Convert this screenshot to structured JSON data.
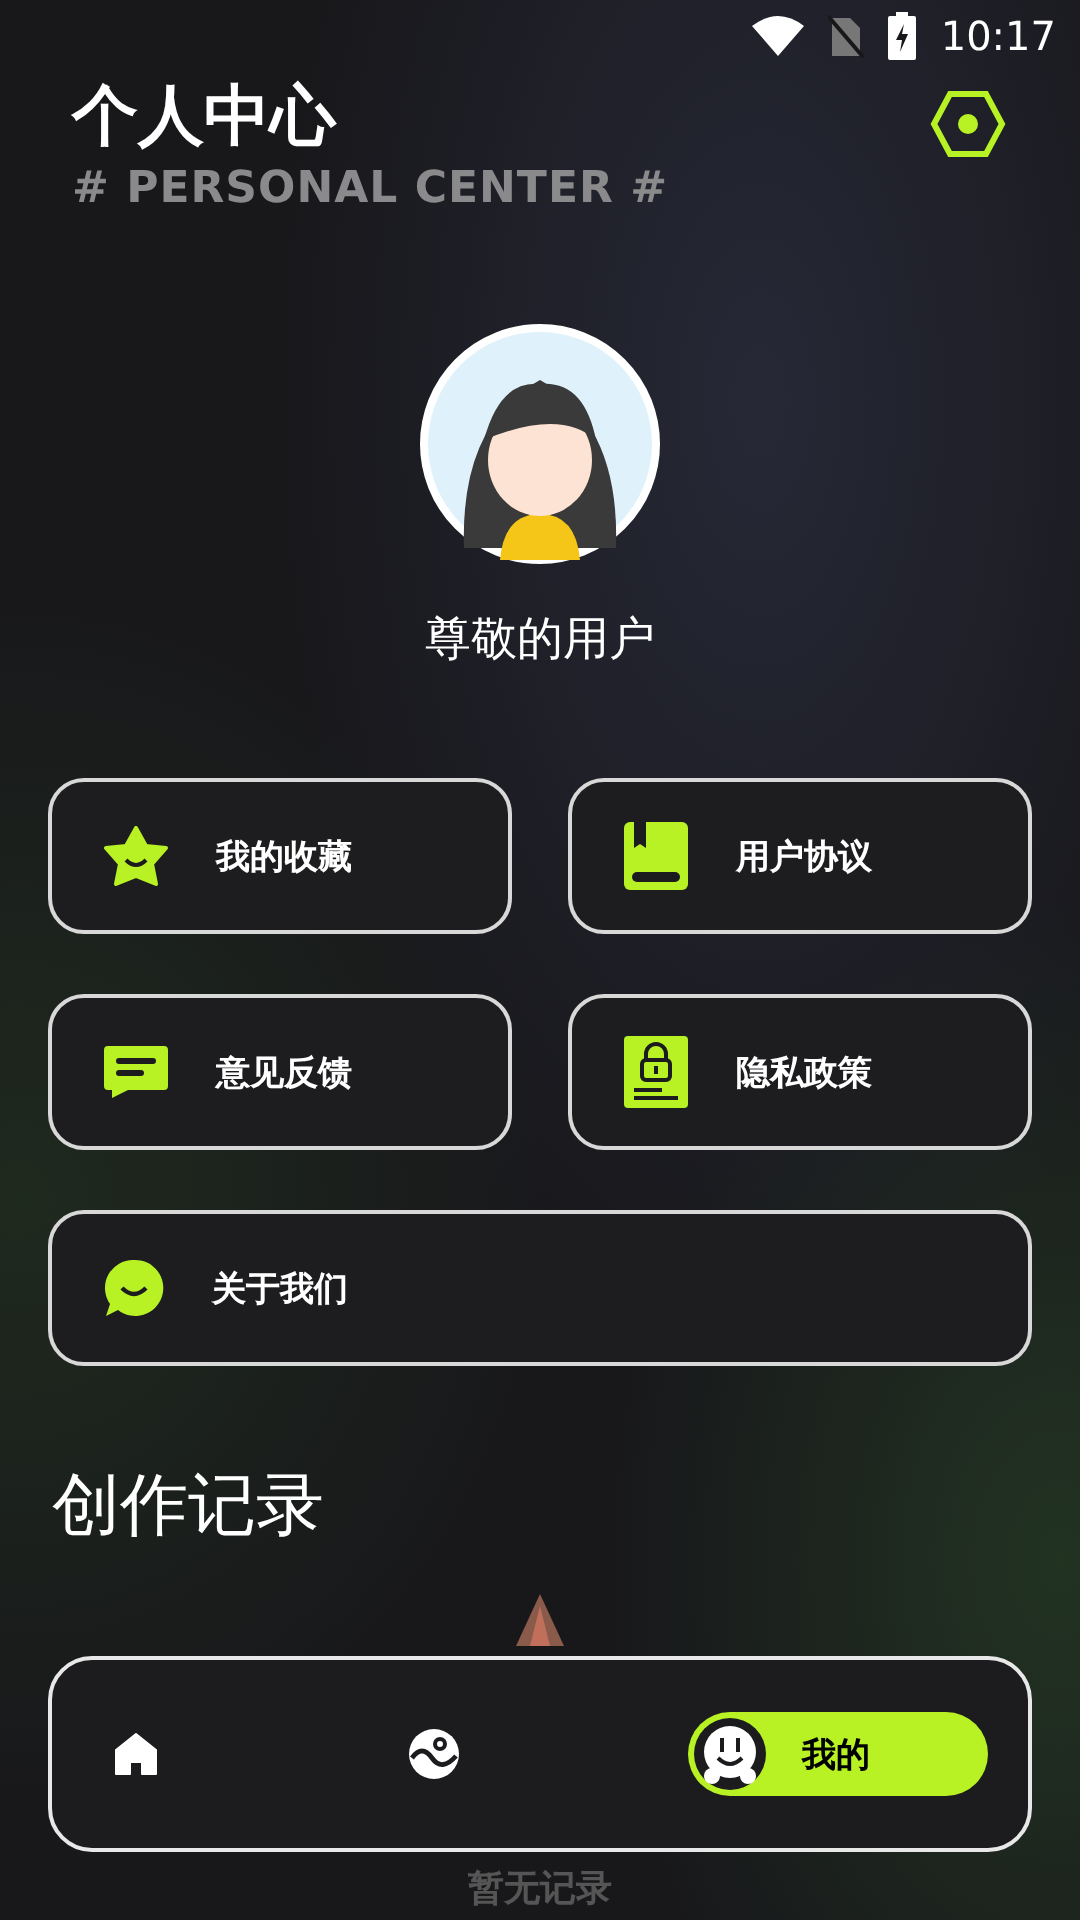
{
  "status_bar": {
    "time": "10:17"
  },
  "header": {
    "title": "个人中心",
    "subtitle": "# PERSONAL CENTER #"
  },
  "profile": {
    "name": "尊敬的用户"
  },
  "menu": [
    {
      "kind": "star",
      "label": "我的收藏"
    },
    {
      "kind": "book",
      "label": "用户协议"
    },
    {
      "kind": "chat",
      "label": "意见反馈"
    },
    {
      "kind": "lock",
      "label": "隐私政策"
    },
    {
      "kind": "smile",
      "label": "关于我们"
    }
  ],
  "records": {
    "title": "创作记录",
    "empty_text": "暂无记录"
  },
  "nav": [
    {
      "kind": "home",
      "selected": false
    },
    {
      "kind": "gallery",
      "selected": false
    },
    {
      "kind": "mine",
      "selected": true,
      "label": "我的"
    }
  ]
}
